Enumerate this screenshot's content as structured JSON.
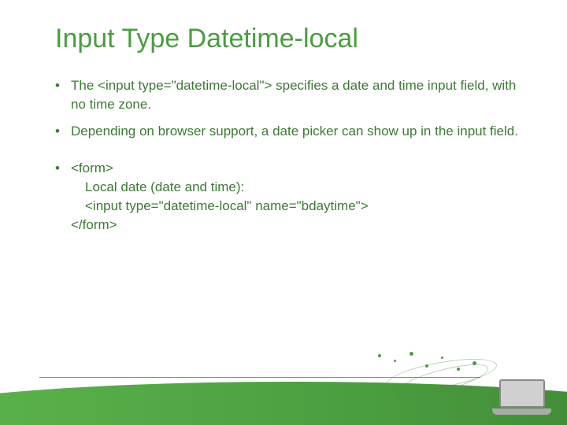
{
  "title": "Input Type Datetime-local",
  "bullets": [
    "The <input type=\"datetime-local\"> specifies a date and time input field, with no time zone.",
    "Depending on browser support, a date picker can show up in the input field."
  ],
  "code": {
    "line1": "<form>",
    "line2": "Local date (date and time):",
    "line3": "<input type=\"datetime-local\" name=\"bdaytime\">",
    "line4": "</form>"
  },
  "colors": {
    "title": "#4a9d3f",
    "body": "#3b7a32"
  }
}
